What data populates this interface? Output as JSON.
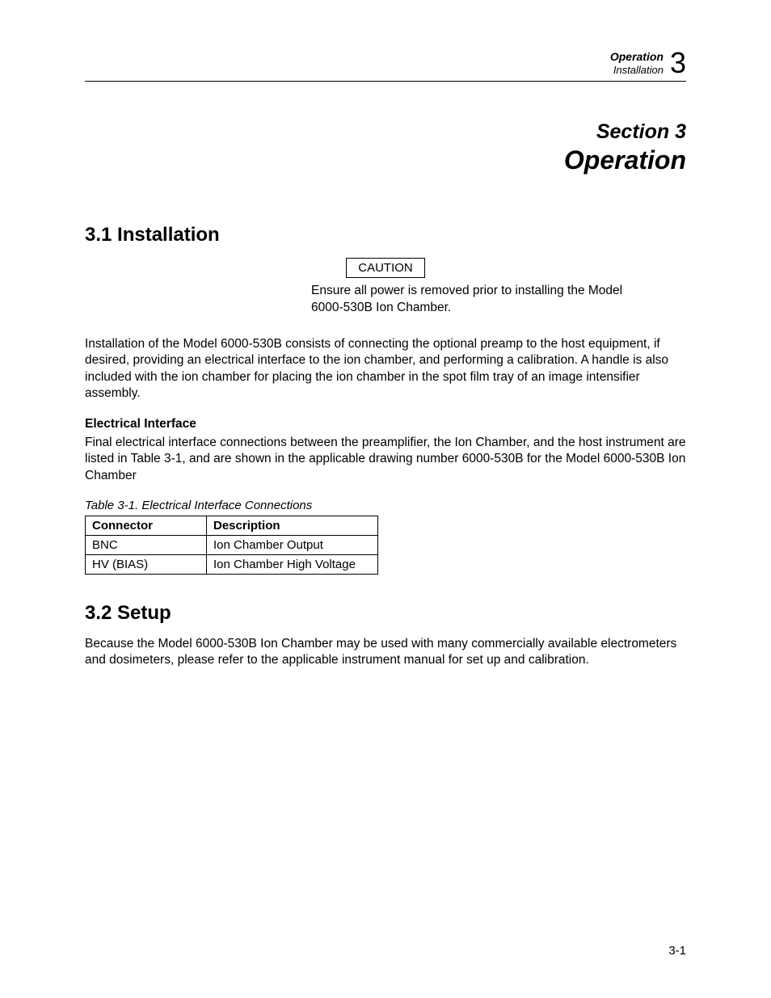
{
  "header": {
    "line1": "Operation",
    "line2": "Installation",
    "chapter_number": "3"
  },
  "section_block": {
    "label": "Section 3",
    "title": "Operation"
  },
  "h2_1": "3.1 Installation",
  "caution_label": "CAUTION",
  "caution_text_line1": "Ensure all power is removed prior to installing the Model",
  "caution_text_line2": "6000-530B Ion Chamber.",
  "para_install": "Installation of the Model 6000-530B consists of connecting the optional preamp to the host equipment, if desired, providing an electrical interface to the ion chamber, and performing a calibration. A handle is also included with the ion chamber for placing the ion chamber in the spot film tray of an image intensifier assembly.",
  "subhead_elec": "Electrical Interface",
  "para_elec": "Final electrical interface connections between the preamplifier, the Ion Chamber, and the host instrument are listed in Table 3-1, and are shown in the applicable drawing number 6000-530B for the Model 6000-530B Ion Chamber",
  "table_caption": "Table 3-1.  Electrical Interface Connections",
  "table": {
    "headers": {
      "connector": "Connector",
      "description": "Description"
    },
    "rows": [
      {
        "connector": "BNC",
        "description": "Ion Chamber Output"
      },
      {
        "connector": "HV (BIAS)",
        "description": "Ion Chamber High Voltage"
      }
    ]
  },
  "h2_2": "3.2 Setup",
  "para_setup": "Because the Model 6000-530B Ion Chamber may be used with many commercially available electrometers and dosimeters, please refer to the applicable instrument manual for set up and calibration.",
  "footer_page": "3-1"
}
